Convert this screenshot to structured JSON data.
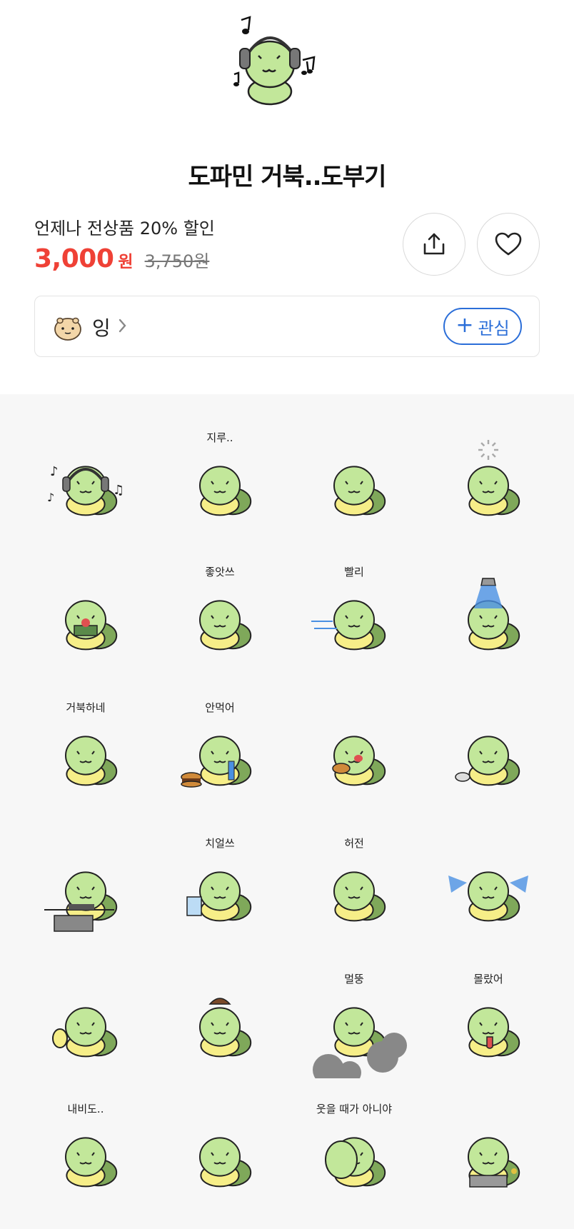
{
  "product": {
    "title": "도파민 거북..도부기",
    "promo": "언제나 전상품 20% 할인",
    "price": "3,000",
    "currency": "원",
    "original_price": "3,750원"
  },
  "actions": {
    "share_icon": "share-icon",
    "like_icon": "heart-icon"
  },
  "artist": {
    "name": "잉",
    "follow_label": "관심",
    "follow_icon": "plus-icon"
  },
  "colors": {
    "accent_red": "#ef4136",
    "accent_blue": "#2b6ed8",
    "turtle_green": "#c2e79a",
    "shell_yellow": "#f6ee88"
  },
  "stickers": [
    {
      "caption": "",
      "variant": "headphones"
    },
    {
      "caption": "지루..",
      "variant": "back"
    },
    {
      "caption": "",
      "variant": "phone"
    },
    {
      "caption": "",
      "variant": "loading"
    },
    {
      "caption": "",
      "variant": "money"
    },
    {
      "caption": "좋앗쓰",
      "variant": "happy"
    },
    {
      "caption": "빨리",
      "variant": "run"
    },
    {
      "caption": "",
      "variant": "shower"
    },
    {
      "caption": "거북하네",
      "variant": "plain"
    },
    {
      "caption": "안먹어",
      "variant": "burger-refuse"
    },
    {
      "caption": "",
      "variant": "eat"
    },
    {
      "caption": "",
      "variant": "bow"
    },
    {
      "caption": "",
      "variant": "computer"
    },
    {
      "caption": "치얼쓰",
      "variant": "cheers"
    },
    {
      "caption": "허전",
      "variant": "empty"
    },
    {
      "caption": "",
      "variant": "cry"
    },
    {
      "caption": "",
      "variant": "thumbs"
    },
    {
      "caption": "",
      "variant": "poop"
    },
    {
      "caption": "멀뚱",
      "variant": "rocks"
    },
    {
      "caption": "몰랐어",
      "variant": "tongue"
    },
    {
      "caption": "내비도..",
      "variant": "lying"
    },
    {
      "caption": "",
      "variant": "plain"
    },
    {
      "caption": "웃을 때가 아니야",
      "variant": "two"
    },
    {
      "caption": "",
      "variant": "angry"
    }
  ]
}
